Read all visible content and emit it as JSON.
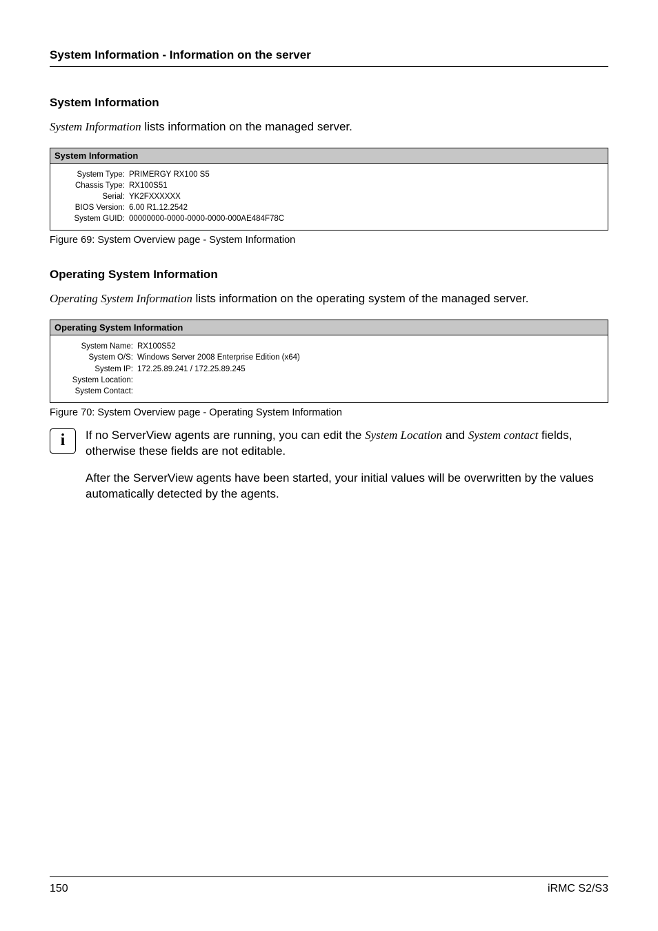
{
  "header": {
    "running": "System Information - Information on the server"
  },
  "section1": {
    "heading": "System Information",
    "intro_italic": "System Information",
    "intro_rest": " lists information on the managed server.",
    "panel_title": "System Information",
    "rows": [
      {
        "label": "System Type:",
        "value": "PRIMERGY RX100 S5"
      },
      {
        "label": "Chassis Type:",
        "value": "RX100S51"
      },
      {
        "label": "Serial:",
        "value": "YK2FXXXXXX"
      },
      {
        "label": "BIOS Version:",
        "value": "6.00 R1.12.2542"
      },
      {
        "label": "System GUID:",
        "value": "00000000-0000-0000-0000-000AE484F78C"
      }
    ],
    "caption": "Figure 69: System Overview page - System Information"
  },
  "section2": {
    "heading": "Operating System Information",
    "intro_italic": "Operating System Information",
    "intro_rest": " lists information on the operating system of the managed server.",
    "panel_title": "Operating System Information",
    "rows": [
      {
        "label": "System Name:",
        "value": "RX100S52"
      },
      {
        "label": "System O/S:",
        "value": "Windows Server 2008 Enterprise Edition (x64)"
      },
      {
        "label": "System IP:",
        "value": "172.25.89.241 / 172.25.89.245"
      },
      {
        "label": "System Location:",
        "value": ""
      },
      {
        "label": "System Contact:",
        "value": ""
      }
    ],
    "caption": "Figure 70: System Overview page - Operating System Information"
  },
  "info": {
    "glyph": "i",
    "p1_a": "If no ServerView agents are running, you can edit the ",
    "p1_it1": "System Location",
    "p1_b": " and ",
    "p1_it2": "System contact",
    "p1_c": " fields, otherwise these fields are not editable.",
    "p2": "After the ServerView agents have been started, your initial values will be overwritten by the values automatically detected by the agents."
  },
  "footer": {
    "page": "150",
    "doc": "iRMC S2/S3"
  }
}
